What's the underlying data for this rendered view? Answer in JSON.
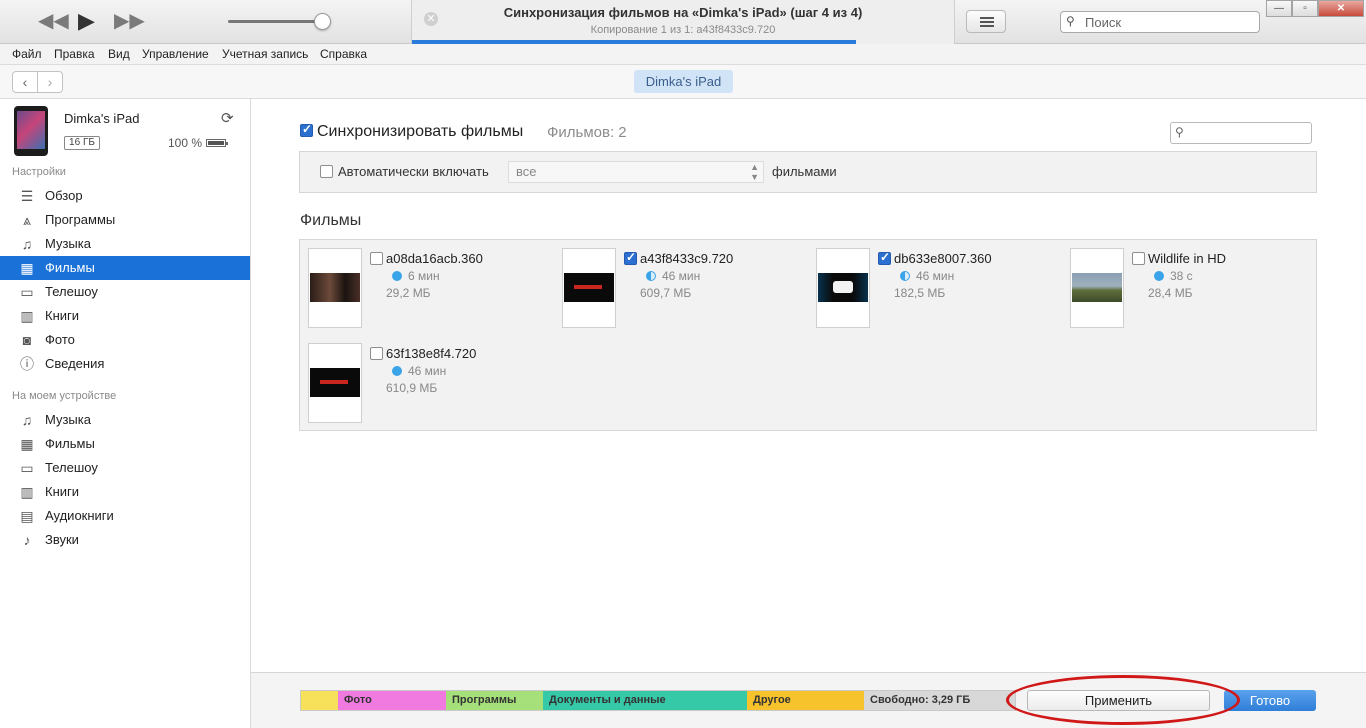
{
  "window": {
    "title": "Синхронизация фильмов на «Dimka's iPad» (шаг 4 из 4)",
    "subtitle": "Копирование 1 из 1: a43f8433c9.720",
    "progress_percent": 82,
    "search_placeholder": "Поиск"
  },
  "menu": [
    "Файл",
    "Правка",
    "Вид",
    "Управление",
    "Учетная запись",
    "Справка"
  ],
  "nav": {
    "device_pill": "Dimka's iPad"
  },
  "device": {
    "name": "Dimka's iPad",
    "capacity": "16 ГБ",
    "battery": "100 %"
  },
  "sidebar": {
    "settings_header": "Настройки",
    "settings_items": [
      {
        "label": "Обзор",
        "icon": "list-icon"
      },
      {
        "label": "Программы",
        "icon": "apps-icon"
      },
      {
        "label": "Музыка",
        "icon": "music-note-icon"
      },
      {
        "label": "Фильмы",
        "icon": "film-icon",
        "active": true
      },
      {
        "label": "Телешоу",
        "icon": "tv-icon"
      },
      {
        "label": "Книги",
        "icon": "book-icon"
      },
      {
        "label": "Фото",
        "icon": "camera-icon"
      },
      {
        "label": "Сведения",
        "icon": "info-icon"
      }
    ],
    "device_header": "На моем устройстве",
    "device_items": [
      {
        "label": "Музыка",
        "icon": "music-note-icon"
      },
      {
        "label": "Фильмы",
        "icon": "film-icon"
      },
      {
        "label": "Телешоу",
        "icon": "tv-icon"
      },
      {
        "label": "Книги",
        "icon": "book-icon"
      },
      {
        "label": "Аудиокниги",
        "icon": "audiobook-icon"
      },
      {
        "label": "Звуки",
        "icon": "bell-icon"
      }
    ]
  },
  "main": {
    "sync_label": "Синхронизировать фильмы",
    "sync_checked": true,
    "films_count": "Фильмов: 2",
    "auto_label": "Автоматически включать",
    "auto_value": "все",
    "auto_after": "фильмами",
    "films_header": "Фильмы",
    "films": [
      {
        "name": "a08da16acb.360",
        "duration": "6 мин",
        "size": "29,2 МБ",
        "checked": false,
        "played": "full"
      },
      {
        "name": "a43f8433c9.720",
        "duration": "46 мин",
        "size": "609,7 МБ",
        "checked": true,
        "played": "half"
      },
      {
        "name": "db633e8007.360",
        "duration": "46 мин",
        "size": "182,5 МБ",
        "checked": true,
        "played": "half"
      },
      {
        "name": "Wildlife in HD",
        "duration": "38 с",
        "size": "28,4 МБ",
        "checked": false,
        "played": "full"
      },
      {
        "name": "63f138e8f4.720",
        "duration": "46 мин",
        "size": "610,9 МБ",
        "checked": false,
        "played": "full"
      }
    ]
  },
  "storage": {
    "segments": [
      {
        "label": "",
        "color": "#f7e05a"
      },
      {
        "label": "Фото",
        "color": "#f07ae0"
      },
      {
        "label": "Программы",
        "color": "#a6e07a"
      },
      {
        "label": "Документы и данные",
        "color": "#36c9a8"
      },
      {
        "label": "Другое",
        "color": "#f6c32c"
      },
      {
        "label": "Свободно: 3,29 ГБ",
        "color": "#d8d8d8"
      }
    ],
    "apply_label": "Применить",
    "done_label": "Готово"
  }
}
